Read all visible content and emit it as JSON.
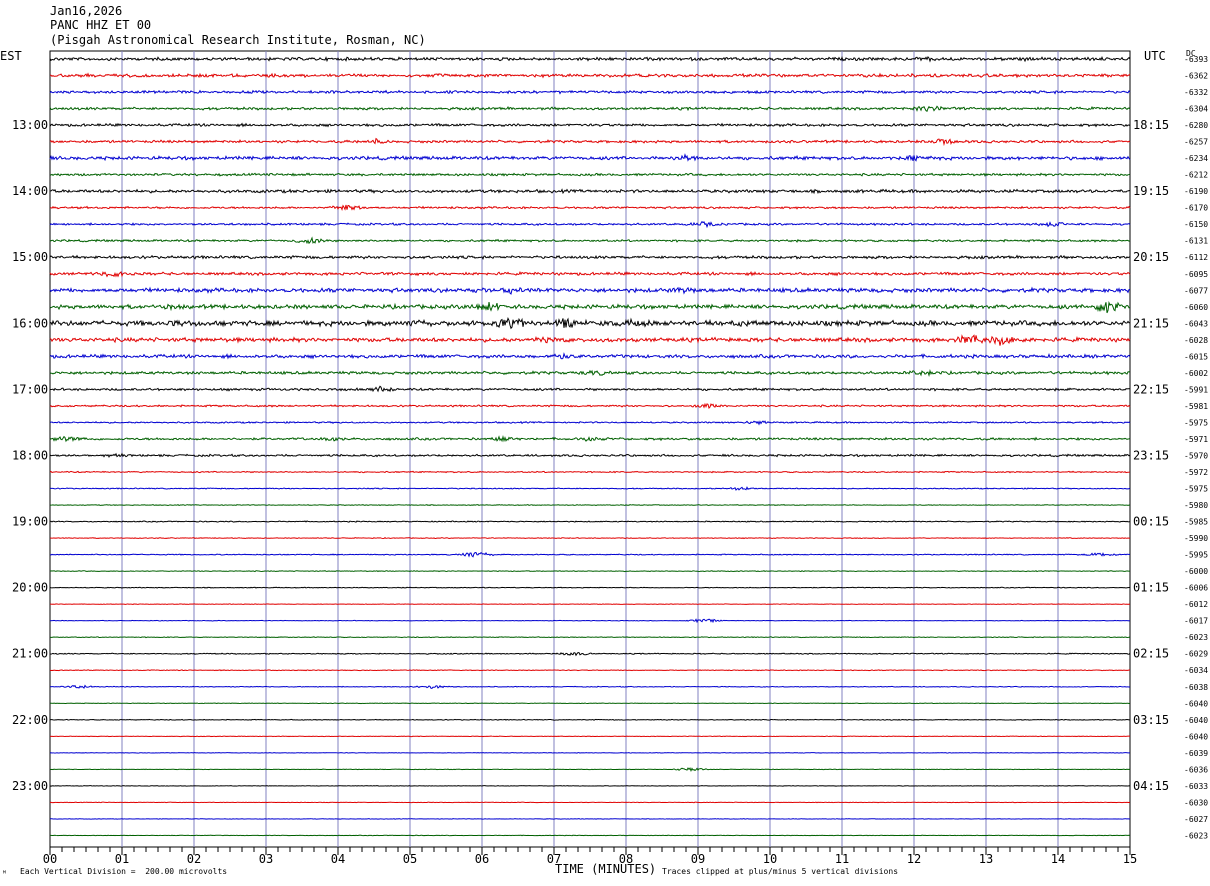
{
  "header": {
    "date": "Jan16,2026",
    "station": "PANC HHZ ET 00",
    "institute": "(Pisgah Astronomical Research Institute, Rosman, NC)"
  },
  "left_tz": "EST",
  "right_tz": "UTC",
  "dc_header": "DC",
  "footer": {
    "scale_note": "Each Vertical Division =  200.00 microvolts",
    "clip_note": "Traces clipped at plus/minus 5 vertical divisions",
    "corner_mark": "ᴹ"
  },
  "colors": {
    "trace_cycle": [
      "#000000",
      "#e00000",
      "#0000d0",
      "#006000"
    ],
    "grid": "#8080c0"
  },
  "chart_data": {
    "type": "line",
    "title": "PANC HHZ ET 00",
    "xlabel": "TIME (MINUTES)",
    "xlim": [
      0,
      15
    ],
    "x_ticks": [
      "00",
      "01",
      "02",
      "03",
      "04",
      "05",
      "06",
      "07",
      "08",
      "09",
      "10",
      "11",
      "12",
      "13",
      "14",
      "15"
    ],
    "left_time_labels": [
      "13:00",
      "14:00",
      "15:00",
      "16:00",
      "17:00",
      "18:00",
      "19:00",
      "20:00",
      "21:00",
      "22:00",
      "23:00"
    ],
    "right_time_labels": [
      "18:15",
      "19:15",
      "20:15",
      "21:15",
      "22:15",
      "23:15",
      "00:15",
      "01:15",
      "02:15",
      "03:15",
      "04:15"
    ],
    "dc_offsets": [
      "-6393",
      "-6362",
      "-6332",
      "-6304",
      "-6280",
      "-6257",
      "-6234",
      "-6212",
      "-6190",
      "-6170",
      "-6150",
      "-6131",
      "-6112",
      "-6095",
      "-6077",
      "-6060",
      "-6043",
      "-6028",
      "-6015",
      "-6002",
      "-5991",
      "-5981",
      "-5975",
      "-5971",
      "-5970",
      "-5972",
      "-5975",
      "-5980",
      "-5985",
      "-5990",
      "-5995",
      "-6000",
      "-6006",
      "-6012",
      "-6017",
      "-6023",
      "-6029",
      "-6034",
      "-6038",
      "-6040",
      "-6040",
      "-6040",
      "-6039",
      "-6036",
      "-6033",
      "-6030",
      "-6027",
      "-6023"
    ],
    "trace_activity": [
      1.2,
      1.2,
      1.0,
      1.0,
      1.0,
      1.0,
      1.3,
      0.9,
      1.2,
      0.8,
      0.8,
      0.8,
      1.1,
      1.1,
      1.6,
      1.6,
      2.0,
      1.6,
      1.3,
      1.1,
      0.9,
      0.7,
      0.6,
      0.9,
      0.8,
      0.5,
      0.4,
      0.3,
      0.4,
      0.3,
      0.4,
      0.3,
      0.3,
      0.2,
      0.2,
      0.3,
      0.4,
      0.3,
      0.3,
      0.2,
      0.3,
      0.2,
      0.2,
      0.2,
      0.2,
      0.2,
      0.2,
      0.2
    ],
    "events": [
      {
        "trace": 0,
        "x": 12.2,
        "amp": 1.8
      },
      {
        "trace": 0,
        "x": 13.5,
        "amp": 1.6
      },
      {
        "trace": 1,
        "x": 12.3,
        "amp": 1.2
      },
      {
        "trace": 3,
        "x": 12.2,
        "amp": 2.5
      },
      {
        "trace": 5,
        "x": 4.5,
        "amp": 2.2
      },
      {
        "trace": 5,
        "x": 12.4,
        "amp": 2.4
      },
      {
        "trace": 6,
        "x": 8.8,
        "amp": 2.8
      },
      {
        "trace": 6,
        "x": 12.0,
        "amp": 2.2
      },
      {
        "trace": 9,
        "x": 4.1,
        "amp": 2.4
      },
      {
        "trace": 10,
        "x": 9.1,
        "amp": 2.0
      },
      {
        "trace": 10,
        "x": 13.9,
        "amp": 2.0
      },
      {
        "trace": 11,
        "x": 3.6,
        "amp": 2.5
      },
      {
        "trace": 13,
        "x": 0.9,
        "amp": 2.6
      },
      {
        "trace": 14,
        "x": 6.4,
        "amp": 2.6
      },
      {
        "trace": 14,
        "x": 8.8,
        "amp": 2.6
      },
      {
        "trace": 15,
        "x": 1.7,
        "amp": 2.0
      },
      {
        "trace": 15,
        "x": 6.1,
        "amp": 4.0
      },
      {
        "trace": 15,
        "x": 14.7,
        "amp": 5.0
      },
      {
        "trace": 16,
        "x": 1.8,
        "amp": 2.4
      },
      {
        "trace": 16,
        "x": 5.1,
        "amp": 3.2
      },
      {
        "trace": 16,
        "x": 6.4,
        "amp": 5.0
      },
      {
        "trace": 16,
        "x": 7.2,
        "amp": 4.5
      },
      {
        "trace": 16,
        "x": 8.0,
        "amp": 3.4
      },
      {
        "trace": 16,
        "x": 9.6,
        "amp": 2.6
      },
      {
        "trace": 17,
        "x": 6.9,
        "amp": 2.6
      },
      {
        "trace": 17,
        "x": 12.8,
        "amp": 4.5
      },
      {
        "trace": 17,
        "x": 13.2,
        "amp": 4.0
      },
      {
        "trace": 18,
        "x": 7.1,
        "amp": 2.6
      },
      {
        "trace": 19,
        "x": 7.6,
        "amp": 2.2
      },
      {
        "trace": 19,
        "x": 12.1,
        "amp": 2.4
      },
      {
        "trace": 20,
        "x": 4.6,
        "amp": 2.2
      },
      {
        "trace": 21,
        "x": 9.1,
        "amp": 1.8
      },
      {
        "trace": 22,
        "x": 9.8,
        "amp": 1.6
      },
      {
        "trace": 23,
        "x": 0.2,
        "amp": 2.2
      },
      {
        "trace": 23,
        "x": 3.9,
        "amp": 1.8
      },
      {
        "trace": 23,
        "x": 6.3,
        "amp": 2.0
      },
      {
        "trace": 23,
        "x": 7.5,
        "amp": 1.8
      },
      {
        "trace": 24,
        "x": 0.9,
        "amp": 1.6
      },
      {
        "trace": 26,
        "x": 9.6,
        "amp": 1.4
      },
      {
        "trace": 30,
        "x": 5.9,
        "amp": 2.4
      },
      {
        "trace": 30,
        "x": 14.6,
        "amp": 1.5
      },
      {
        "trace": 34,
        "x": 9.1,
        "amp": 1.4
      },
      {
        "trace": 36,
        "x": 7.3,
        "amp": 1.4
      },
      {
        "trace": 38,
        "x": 0.4,
        "amp": 1.3
      },
      {
        "trace": 38,
        "x": 5.3,
        "amp": 1.4
      },
      {
        "trace": 43,
        "x": 8.9,
        "amp": 1.3
      }
    ]
  }
}
